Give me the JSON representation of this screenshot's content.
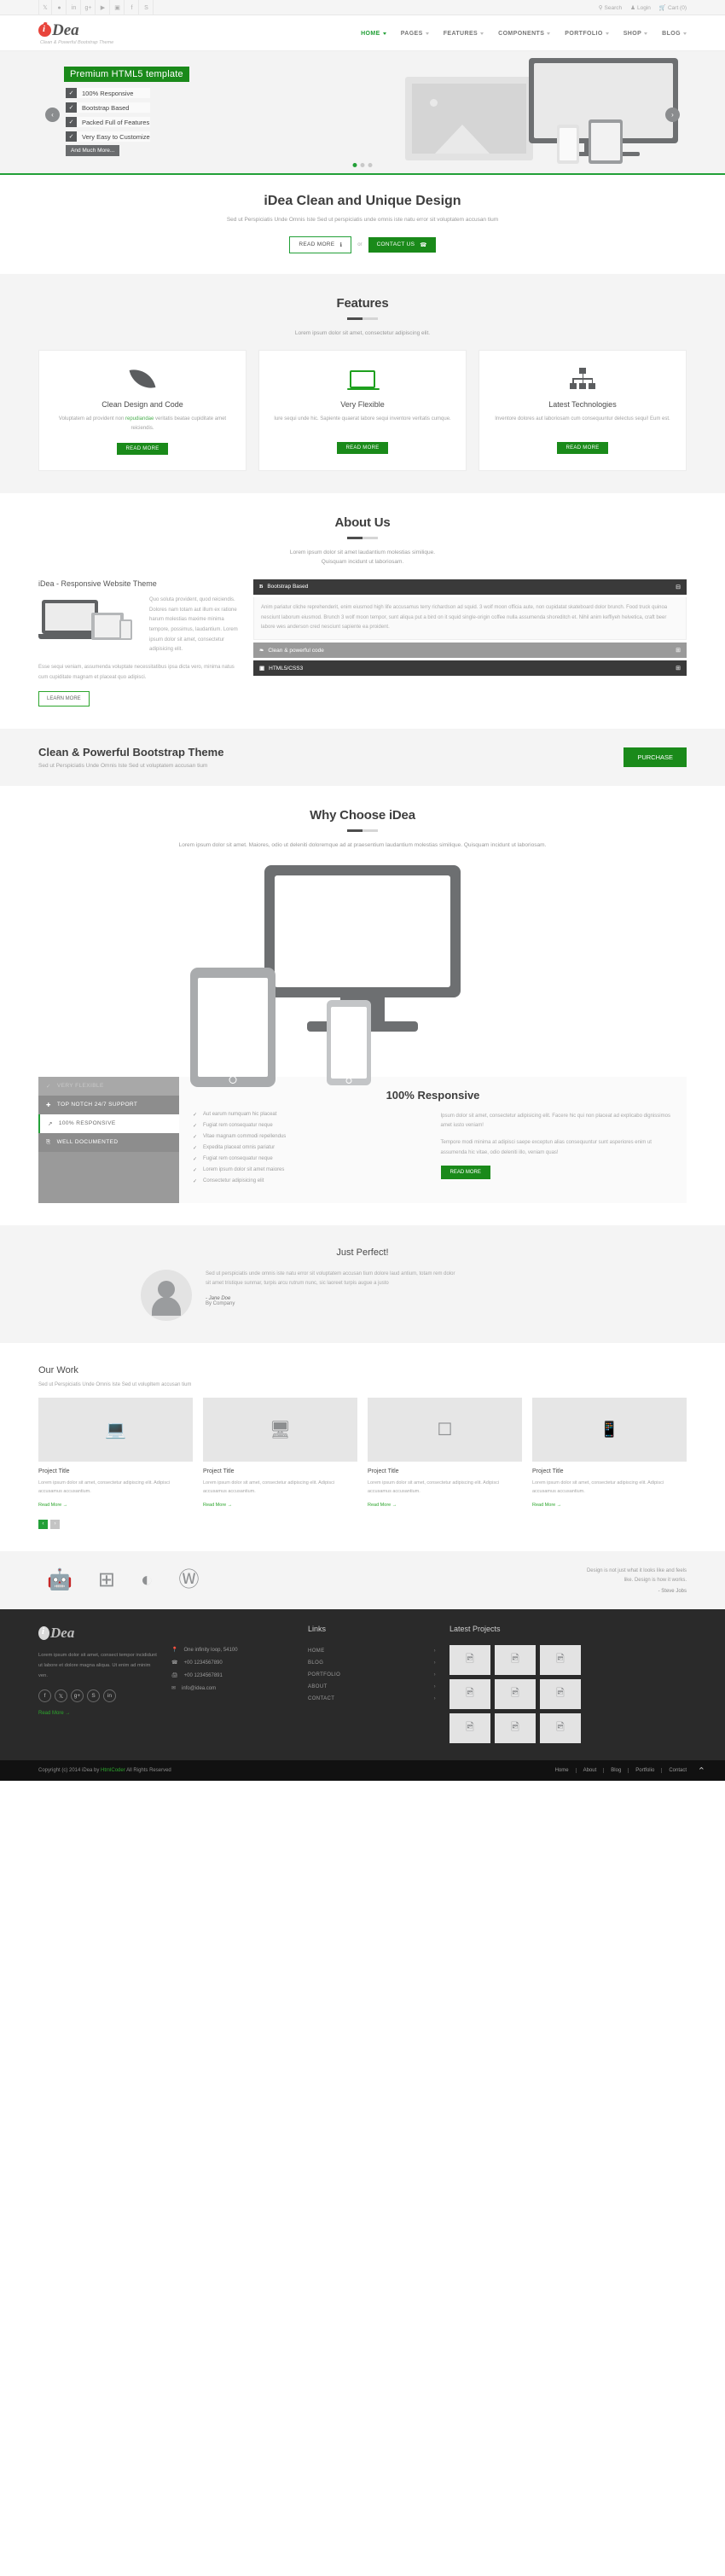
{
  "topbar": {
    "social": [
      "twitter-icon",
      "dribbble-icon",
      "linkedin-icon",
      "gplus-icon",
      "youtube-icon",
      "flickr-icon",
      "facebook-icon",
      "skype-icon"
    ],
    "social_glyphs": [
      "𝕏",
      "●",
      "in",
      "g+",
      "▶",
      "▣",
      "f",
      "S"
    ],
    "search_label": "Search",
    "login_label": "Login",
    "cart_label": "Cart (0)"
  },
  "header": {
    "logo_text": "Dea",
    "logo_initial": "i",
    "tagline": "Clean & Powerful Bootstrap Theme",
    "nav": [
      {
        "label": "HOME",
        "active": true
      },
      {
        "label": "PAGES",
        "active": false
      },
      {
        "label": "FEATURES",
        "active": false
      },
      {
        "label": "COMPONENTS",
        "active": false
      },
      {
        "label": "PORTFOLIO",
        "active": false
      },
      {
        "label": "SHOP",
        "active": false
      },
      {
        "label": "BLOG",
        "active": false
      }
    ]
  },
  "slider": {
    "badge": "Premium HTML5 template",
    "items": [
      "100% Responsive",
      "Bootstrap Based",
      "Packed Full of Features",
      "Very Easy to Customize"
    ],
    "check_glyph": "✓",
    "more_label": "And Much More...",
    "prev_glyph": "‹",
    "next_glyph": "›",
    "dots": [
      true,
      false,
      false
    ]
  },
  "intro": {
    "title": "iDea Clean and Unique Design",
    "text": "Sed ut Perspiciatis Unde Omnis Iste Sed ut perspiciatis unde omnis iste natu error sit voluptatem accusan tium",
    "btn_read": "READ MORE",
    "btn_read_icon": "info-icon",
    "btn_read_glyph": "ℹ",
    "or": "or",
    "btn_contact": "CONTACT US",
    "btn_contact_glyph": "☎"
  },
  "features": {
    "title": "Features",
    "subtitle": "Lorem ipsum dolor sit amet, consectetur adipiscing elit.",
    "cards": [
      {
        "icon": "leaf-icon",
        "title": "Clean Design and Code",
        "text_a": "Voluptatem ad provident non ",
        "text_link": "repudiandae",
        "text_b": " veritatis beatae cupiditate amet reiciendis.",
        "btn": "READ MORE"
      },
      {
        "icon": "laptop-icon",
        "title": "Very Flexible",
        "text_a": "Iure sequi unde hic. Sapiente quaerat labore sequi inventore veritatis cumque.",
        "text_link": "",
        "text_b": "",
        "btn": "READ MORE"
      },
      {
        "icon": "sitemap-icon",
        "title": "Latest Technologies",
        "text_a": "Inventore dolores aut laboriosam cum consequuntur delectus sequi! Eum est.",
        "text_link": "",
        "text_b": "",
        "btn": "READ MORE"
      }
    ]
  },
  "about": {
    "title": "About Us",
    "subtitle": "Lorem ipsum dolor sit amet laudantium molestias similique.\nQuisquam incidunt ut laboriosam.",
    "sub_line1": "Lorem ipsum dolor sit amet laudantium molestias similique.",
    "sub_line2": "Quisquam incidunt ut laboriosam.",
    "left_heading": "iDea - Responsive Website Theme",
    "para1": "Quo soluta provident, quod reiciendis. Dolores nam totam aut illum ex ratione harum molestias maxime minima tempore, possimus, laudantium. Lorem ipsum dolor sit amet, consectetur adipisicing elit.",
    "para2": "Esse sequi veniam, assumenda voluptate necessitatibus ipsa dicta vero, minima natus cum cupiditate magnam et placeat quo adipisci.",
    "learn_btn": "LEARN MORE",
    "accordion": [
      {
        "icon": "bootstrap-icon",
        "glyph": "B",
        "label": "Bootstrap Based",
        "state": "open",
        "toggle": "⊟",
        "body": "Anim pariatur cliche reprehenderit, enim eiusmod high life accusamus terry richardson ad squid. 3 wolf moon officia aute, non cupidatat skateboard dolor brunch. Food truck quinoa nesciunt laborum eiusmod. Brunch 3 wolf moon tempor, sunt aliqua put a bird on it squid single-origin coffee nulla assumenda shoreditch et. Nihil anim keffiyeh helvetica, craft beer labore wes anderson cred nesciunt sapiente ea proident."
      },
      {
        "icon": "leaf-icon",
        "glyph": "❧",
        "label": "Clean & powerful code",
        "state": "closed",
        "toggle": "⊞",
        "body": ""
      },
      {
        "icon": "html5-icon",
        "glyph": "▣",
        "label": "HTML5/CSS3",
        "state": "closed",
        "toggle": "⊞",
        "body": ""
      }
    ]
  },
  "cta": {
    "title": "Clean & Powerful Bootstrap Theme",
    "text": "Sed ut Perspiciatis Unde Omnis Iste Sed ut voluptatem accusan tium",
    "button": "PURCHASE"
  },
  "why": {
    "title": "Why Choose iDea",
    "text": "Lorem ipsum dolor sit amet. Maiores, odio ut deleniti doloremque ad at praesentium laudantium molestias similique. Quisquam incidunt ut laboriosam."
  },
  "responsive_tabs": {
    "tabs": [
      {
        "label": "VERY FLEXIBLE",
        "icon": "check-icon",
        "glyph": "✓",
        "state": "faded"
      },
      {
        "label": "TOP NOTCH 24/7 SUPPORT",
        "icon": "support-icon",
        "glyph": "✚",
        "state": "mid"
      },
      {
        "label": "100% RESPONSIVE",
        "icon": "expand-icon",
        "glyph": "↗",
        "state": "active"
      },
      {
        "label": "WELL DOCUMENTED",
        "icon": "document-icon",
        "glyph": "὜B",
        "state": "mid"
      }
    ],
    "panel_title": "100% Responsive",
    "checklist": [
      "Aut earum numquam hic placeat",
      "Fugiat rem consequatur neque",
      "Vitae magnam commodi repellendus",
      "Expedita placeat omnis pariatur",
      "Fugiat rem consequatur neque",
      "Lorem ipsum dolor sit amet maiores",
      "Consectetur adipisicing elit"
    ],
    "check_glyph": "✓",
    "para1": "Ipsum dolor sit amet, consectetur adipisicing elit. Facere hic qui non placeat ad explicabo dignissimos amet iusto veniam!",
    "para2": "Tempore modi minima at adipisci saepe exceptun alias consequuntur sunt asperiores enim ut assumenda hic vitae, odio deleniti illo, veniam quas!",
    "button": "READ MORE"
  },
  "testimonial": {
    "title": "Just Perfect!",
    "quote": "Sed ut perspiciatis unde omnis iste natu error sit voluptatem accusan tium dolore laud antium, totam rem dolor sit amet tristique sunmar, turpis arcu rutrum nunc, sic laoreet turpis augue a justo",
    "author": "- Jane Doe",
    "company": "By Company",
    "avatar": "avatar-icon"
  },
  "work": {
    "title": "Our Work",
    "subtitle": "Sed ut Perspiciatis Unde Omnis Iste Sed ut volupltem accusan tium",
    "items": [
      {
        "icon": "laptop-icon",
        "glyph": "💻",
        "title": "Project Title",
        "text": "Lorem ipsum dolor sit amet, consectetur adipiscing elit. Adipisci accusamus accusantium.",
        "more": "Read More  →"
      },
      {
        "icon": "monitor-icon",
        "glyph": "🖵",
        "title": "Project Title",
        "text": "Lorem ipsum dolor sit amet, consectetur adipiscing elit. Adipisci accusamus accusantium.",
        "more": "Read More  →"
      },
      {
        "icon": "tablet-icon",
        "glyph": "📱",
        "title": "Project Title",
        "text": "Lorem ipsum dolor sit amet, consectetur adipiscing elit. Adipisci accusamus accusantium.",
        "more": "Read More  →"
      },
      {
        "icon": "phone-icon",
        "glyph": "📱",
        "title": "Project Title",
        "text": "Lorem ipsum dolor sit amet, consectetur adipiscing elit. Adipisci accusamus accusantium.",
        "more": "Read More  →"
      }
    ],
    "prev_glyph": "‹",
    "next_glyph": "›"
  },
  "brands": {
    "icons": [
      "android-icon",
      "windows-icon",
      "firefox-icon",
      "wordpress-icon"
    ],
    "glyphs": [
      "🤖",
      "⊞",
      "◐",
      "Ⓦ"
    ],
    "note_line1": "Design is not just what it looks like and feels",
    "note_line2": "like. Design is how it works.",
    "author": "- Steve Jobs"
  },
  "footer": {
    "logo_initial": "i",
    "logo_text": "Dea",
    "about": "Lorem ipsum dolor sit amet, consect tempor incididunt ut labore et dolore magna aliqua. Ut enim ad minim ven.",
    "social": [
      "facebook-icon",
      "twitter-icon",
      "gplus-icon",
      "skype-icon",
      "linkedin-icon"
    ],
    "social_glyphs": [
      "f",
      "𝕏",
      "g+",
      "S",
      "in"
    ],
    "read_more": "Read More  →",
    "contact": [
      {
        "icon": "location-icon",
        "glyph": "📍",
        "text": "One infinity loop, 54100"
      },
      {
        "icon": "phone-icon",
        "glyph": "☎",
        "text": "+00 1234567890"
      },
      {
        "icon": "fax-icon",
        "glyph": "🖨",
        "text": "+00 1234567891"
      },
      {
        "icon": "email-icon",
        "glyph": "✉",
        "text": "info@idea.com"
      }
    ],
    "links_title": "Links",
    "links": [
      "HOME",
      "BLOG",
      "PORTFOLIO",
      "ABOUT",
      "CONTACT"
    ],
    "link_chevron": "›",
    "projects_title": "Latest Projects",
    "project_glyph": "🖼",
    "project_count": 9
  },
  "bottombar": {
    "copyright_a": "Copyright (c) 2014 iDea by ",
    "copyright_link": "HtmlCoder",
    "copyright_b": " All Rights Reserved",
    "links": [
      "Home",
      "About",
      "Blog",
      "Portfolio",
      "Contact"
    ],
    "totop": "⌃"
  },
  "colors": {
    "accent_green": "#23a038",
    "btn_green": "#1a8a1a",
    "logo_red": "#e8453c",
    "dark": "#2a2a2a"
  }
}
